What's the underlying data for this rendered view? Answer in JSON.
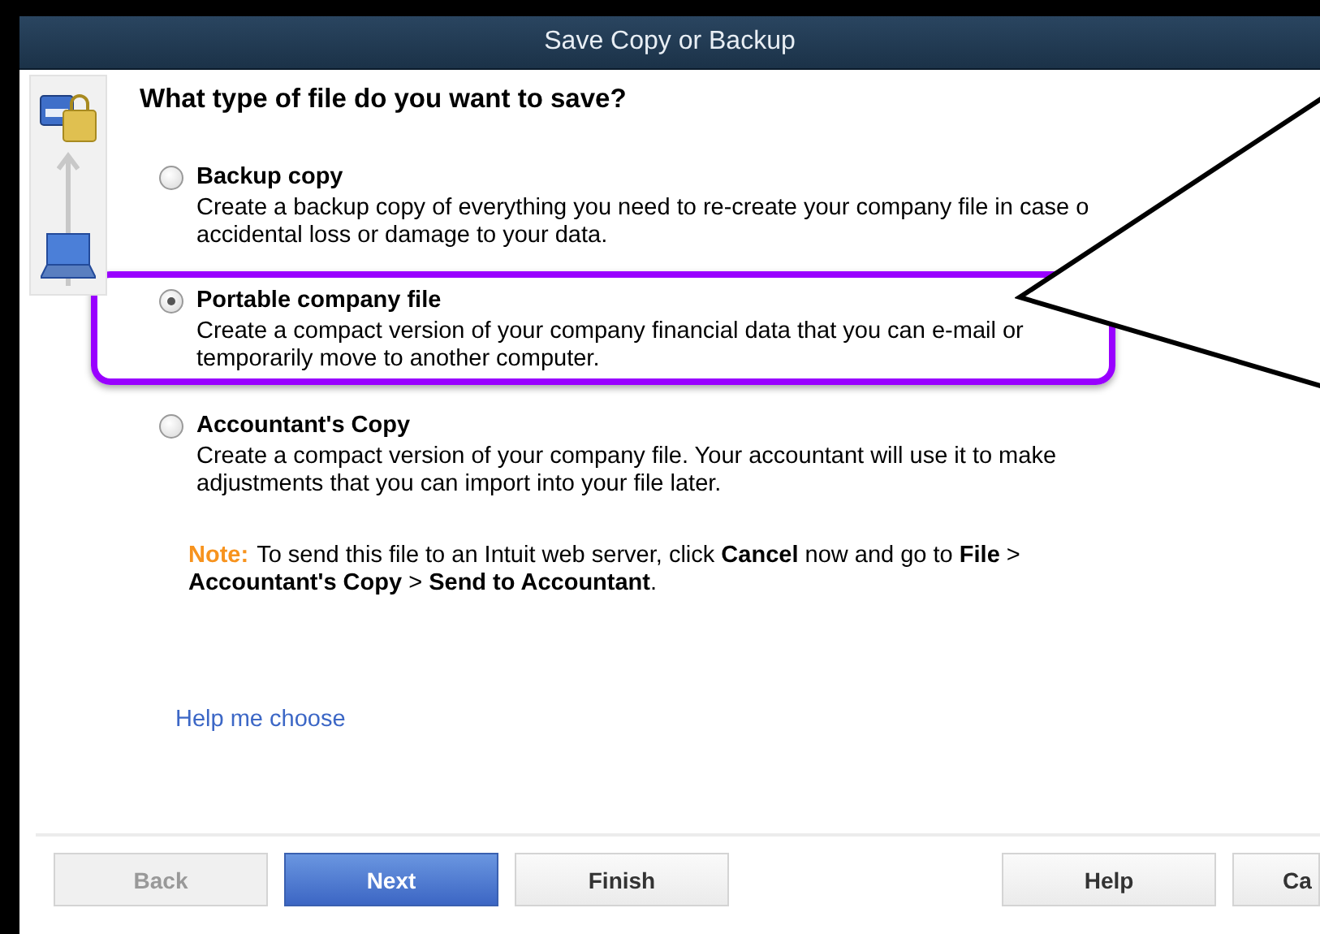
{
  "window": {
    "title": "Save Copy or Backup"
  },
  "heading": "What type of file do you want to save?",
  "options": [
    {
      "label": "Backup copy",
      "description": "Create a backup copy of everything you need to re-create your company file in case o",
      "description_2": "accidental loss or damage to your data.",
      "selected": false,
      "highlighted": false
    },
    {
      "label": "Portable company file",
      "description": "Create a compact version of your company financial data that you can e-mail or",
      "description_2": "temporarily move to another computer.",
      "selected": true,
      "highlighted": true
    },
    {
      "label": "Accountant's Copy",
      "description": "Create a compact version of your company file. Your accountant will use it to make",
      "description_2": "adjustments that you can import into your file later.",
      "selected": false,
      "highlighted": false
    }
  ],
  "note": {
    "label": "Note:",
    "text": "To send this file to an Intuit web server, click **Cancel** now and go to **File** >",
    "text_2": "**Accountant's Copy** > **Send to Accountant**."
  },
  "help_link": "Help me choose",
  "buttons": [
    {
      "label": "Back",
      "kind": "disabled"
    },
    {
      "label": "Next",
      "kind": "primary"
    },
    {
      "label": "Finish",
      "kind": "normal"
    },
    {
      "label": "Help",
      "kind": "normal"
    },
    {
      "label": "Ca",
      "kind": "cut"
    }
  ]
}
